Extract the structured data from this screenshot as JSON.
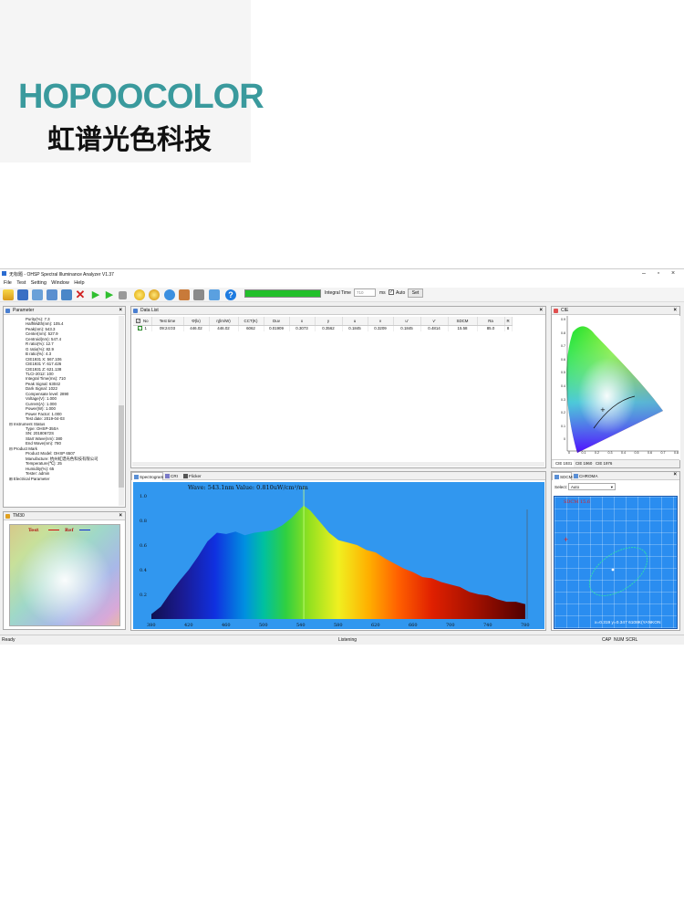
{
  "brand": {
    "name_en": "HOPOOCOLOR",
    "name_cn": "虹谱光色科技"
  },
  "window": {
    "title": "无标题 - OHSP Spectral Illuminance Analyzer V1.37"
  },
  "menu": [
    "File",
    "Test",
    "Setting",
    "Window",
    "Help"
  ],
  "toolbar": {
    "integral_time_label": "Integral Time",
    "integral_time_value": "710",
    "unit": "ms",
    "auto_label": "Auto",
    "auto_checked": "✓",
    "set_label": "Set"
  },
  "parameter_panel": {
    "title": "Parameter",
    "rows": [
      {
        "text": "Purity(%): 7.3",
        "level": 1
      },
      {
        "text": "HalfWidth(nm): 105.4",
        "level": 1
      },
      {
        "text": "Peak(nm): 543.3",
        "level": 1
      },
      {
        "text": "Center(nm): 527.9",
        "level": 1
      },
      {
        "text": "Centroid(nm): 547.4",
        "level": 1
      },
      {
        "text": "R ratio(%): 12.7",
        "level": 1
      },
      {
        "text": "G ratio(%): 82.9",
        "level": 1
      },
      {
        "text": "B ratio(%): 4.3",
        "level": 1
      },
      {
        "text": "CIE1931 X: 567.106",
        "level": 1
      },
      {
        "text": "CIE1931 Y: 617.426",
        "level": 1
      },
      {
        "text": "CIE1931 Z: 621.138",
        "level": 1
      },
      {
        "text": "TLCI-2012: 100",
        "level": 1
      },
      {
        "text": "Integral Time(ms): 710",
        "level": 1
      },
      {
        "text": "Peak Signal: 63042",
        "level": 1
      },
      {
        "text": "Dark Signal: 1022",
        "level": 1
      },
      {
        "text": "Compensate level: 2890",
        "level": 1
      },
      {
        "text": "Voltage(V): 1.000",
        "level": 1
      },
      {
        "text": "Current(A): 1.000",
        "level": 1
      },
      {
        "text": "Power(W): 1.000",
        "level": 1
      },
      {
        "text": "Power Factor: 1.000",
        "level": 1
      },
      {
        "text": "Test date: 2019-04-03",
        "level": 1
      },
      {
        "text": "⊟ Instrument Status",
        "level": 0
      },
      {
        "text": "Type: OHSP-350A",
        "level": 1
      },
      {
        "text": "SN: 20180672S",
        "level": 1
      },
      {
        "text": "Start Wave(nm): 380",
        "level": 1
      },
      {
        "text": "End Wave(nm): 780",
        "level": 1
      },
      {
        "text": "⊟ Product Mark",
        "level": 0
      },
      {
        "text": "Product Model: OHSP 6507",
        "level": 1
      },
      {
        "text": "Manufacture: 杭州虹谱光色科技有限公司",
        "level": 1
      },
      {
        "text": "Temperature(℃): 25",
        "level": 1
      },
      {
        "text": "Humidity(%): 65",
        "level": 1
      },
      {
        "text": "Tester: admin",
        "level": 1
      },
      {
        "text": "⊞ Electrical Parameter",
        "level": 0
      }
    ]
  },
  "data_list": {
    "title": "Data List",
    "columns": [
      "No",
      "Test time",
      "Φ(lx)",
      "η(lm/W)",
      "CCT(K)",
      "Duv",
      "x",
      "y",
      "u",
      "v",
      "u'",
      "v'",
      "SDCM",
      "Ra",
      "R"
    ],
    "rows": [
      [
        "1",
        "09:24:03",
        "446.02",
        "446.02",
        "6062",
        "0.01909",
        "0.3073",
        "0.3562",
        "0.1845",
        "0.3209",
        "0.1845",
        "0.4814",
        "15.58",
        "85.0",
        "8"
      ]
    ]
  },
  "cie_panel": {
    "title": "CIE",
    "tabs": [
      "CIE 1931",
      "CIE 1960",
      "CIE 1976"
    ],
    "x_ticks": [
      "0",
      "0.1",
      "0.2",
      "0.3",
      "0.4",
      "0.5",
      "0.6",
      "0.7",
      "0.8"
    ],
    "y_ticks": [
      "0.9",
      "0.8",
      "0.7",
      "0.6",
      "0.5",
      "0.4",
      "0.3",
      "0.2",
      "0.1",
      "0"
    ]
  },
  "spectrum_panel": {
    "tabs": [
      "Spectrogram",
      "CRI",
      "Flicker"
    ],
    "readout": "Wave: 543.1nm Value: 0.810uW/cm²/nm",
    "y_ticks": [
      "1.0",
      "0.8",
      "0.6",
      "0.4",
      "0.2"
    ],
    "x_ticks": [
      "380",
      "420",
      "460",
      "500",
      "540",
      "580",
      "620",
      "660",
      "700",
      "740",
      "780"
    ]
  },
  "chart_data": {
    "type": "area",
    "title": "",
    "xlabel": "",
    "ylabel": "",
    "xlim": [
      380,
      780
    ],
    "ylim": [
      0,
      1.0
    ],
    "x": [
      380,
      390,
      400,
      410,
      420,
      430,
      440,
      450,
      460,
      470,
      480,
      490,
      500,
      510,
      520,
      530,
      540,
      543,
      550,
      560,
      570,
      580,
      590,
      600,
      610,
      620,
      630,
      640,
      650,
      660,
      670,
      680,
      690,
      700,
      710,
      720,
      730,
      740,
      750,
      760,
      770,
      780
    ],
    "series": [
      {
        "values": [
          0.04,
          0.1,
          0.21,
          0.31,
          0.4,
          0.51,
          0.63,
          0.7,
          0.69,
          0.71,
          0.68,
          0.7,
          0.71,
          0.72,
          0.76,
          0.82,
          0.9,
          0.92,
          0.88,
          0.79,
          0.7,
          0.64,
          0.62,
          0.6,
          0.56,
          0.54,
          0.49,
          0.45,
          0.41,
          0.38,
          0.34,
          0.33,
          0.3,
          0.28,
          0.26,
          0.22,
          0.2,
          0.19,
          0.16,
          0.14,
          0.14,
          0.12
        ]
      }
    ],
    "marker_x": 543
  },
  "tm30_panel": {
    "title": "TM30",
    "legend_test": "Test",
    "legend_ref": "Ref"
  },
  "sdcm_panel": {
    "tabs": [
      "SDCM",
      "CHROMA"
    ],
    "select_label": "Select:",
    "select_value": "Auto",
    "plot_label": "SDCM 15.6",
    "footer": "x=0.319 y=0.347 6108K(YANKON"
  },
  "status": {
    "left": "Ready",
    "center": "Listening",
    "caps": "CAP",
    "num": "NUM",
    "scrl": "SCRL"
  },
  "colors": {
    "accent_blue": "#2e8ff0",
    "progress_green": "#22c02a",
    "brand_teal": "#3a9a9d"
  }
}
